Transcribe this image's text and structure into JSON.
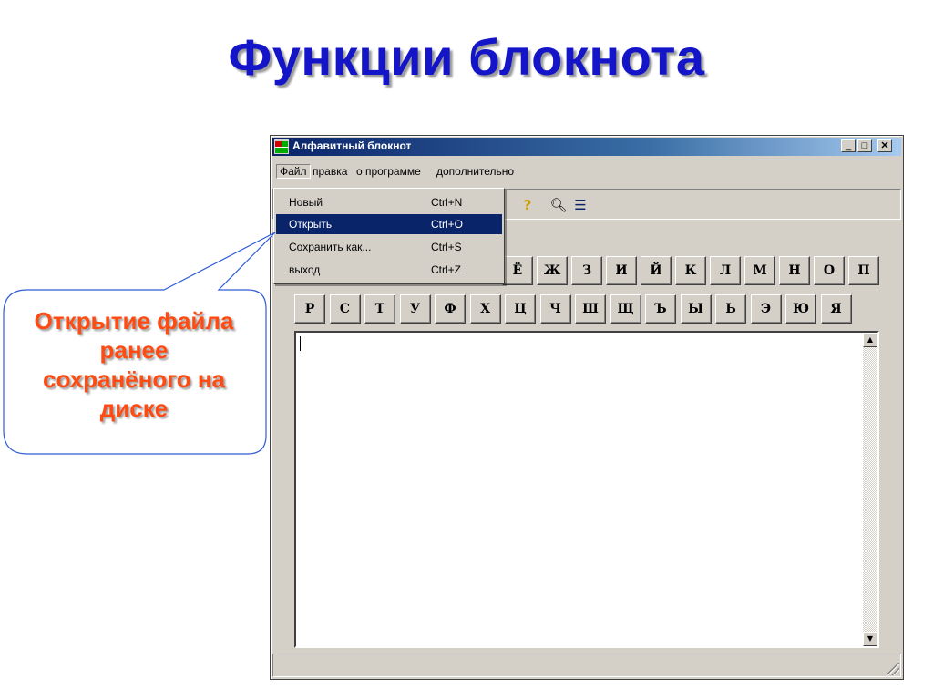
{
  "slide": {
    "title": "Функции блокнота"
  },
  "window": {
    "title": "Алфавитный блокнот",
    "minimize": "_",
    "maximize": "□",
    "close": "✕",
    "menu": [
      "Файл",
      "правка",
      "о программе",
      "дополнительно"
    ]
  },
  "file_menu": [
    {
      "label": "Новый",
      "shortcut": "Ctrl+N"
    },
    {
      "label": "Открыть",
      "shortcut": "Ctrl+O"
    },
    {
      "label": "Сохранить как...",
      "shortcut": "Ctrl+S"
    },
    {
      "label": "выход",
      "shortcut": "Ctrl+Z"
    }
  ],
  "toolbar": {
    "icons": [
      "help-icon",
      "find-icon",
      "list-icon"
    ],
    "help_glyph": "?",
    "find_glyph": "🔍︎",
    "list_glyph": "☰"
  },
  "letters": {
    "row1": [
      "Ё",
      "Ж",
      "З",
      "И",
      "Й",
      "К",
      "Л",
      "М",
      "Н",
      "О",
      "П"
    ],
    "row2": [
      "Р",
      "С",
      "Т",
      "У",
      "Ф",
      "Х",
      "Ц",
      "Ч",
      "Ш",
      "Щ",
      "Ъ",
      "Ы",
      "Ь",
      "Э",
      "Ю",
      "Я"
    ]
  },
  "scroll": {
    "up": "▲",
    "down": "▼"
  },
  "callout": {
    "lines": [
      "Открытие файла",
      "ранее",
      "сохранёного на",
      "диске"
    ]
  },
  "colors": {
    "title": "#1414c8",
    "callout_text": "#ff4a12",
    "selection": "#0a246a",
    "face": "#d4d0c8"
  }
}
